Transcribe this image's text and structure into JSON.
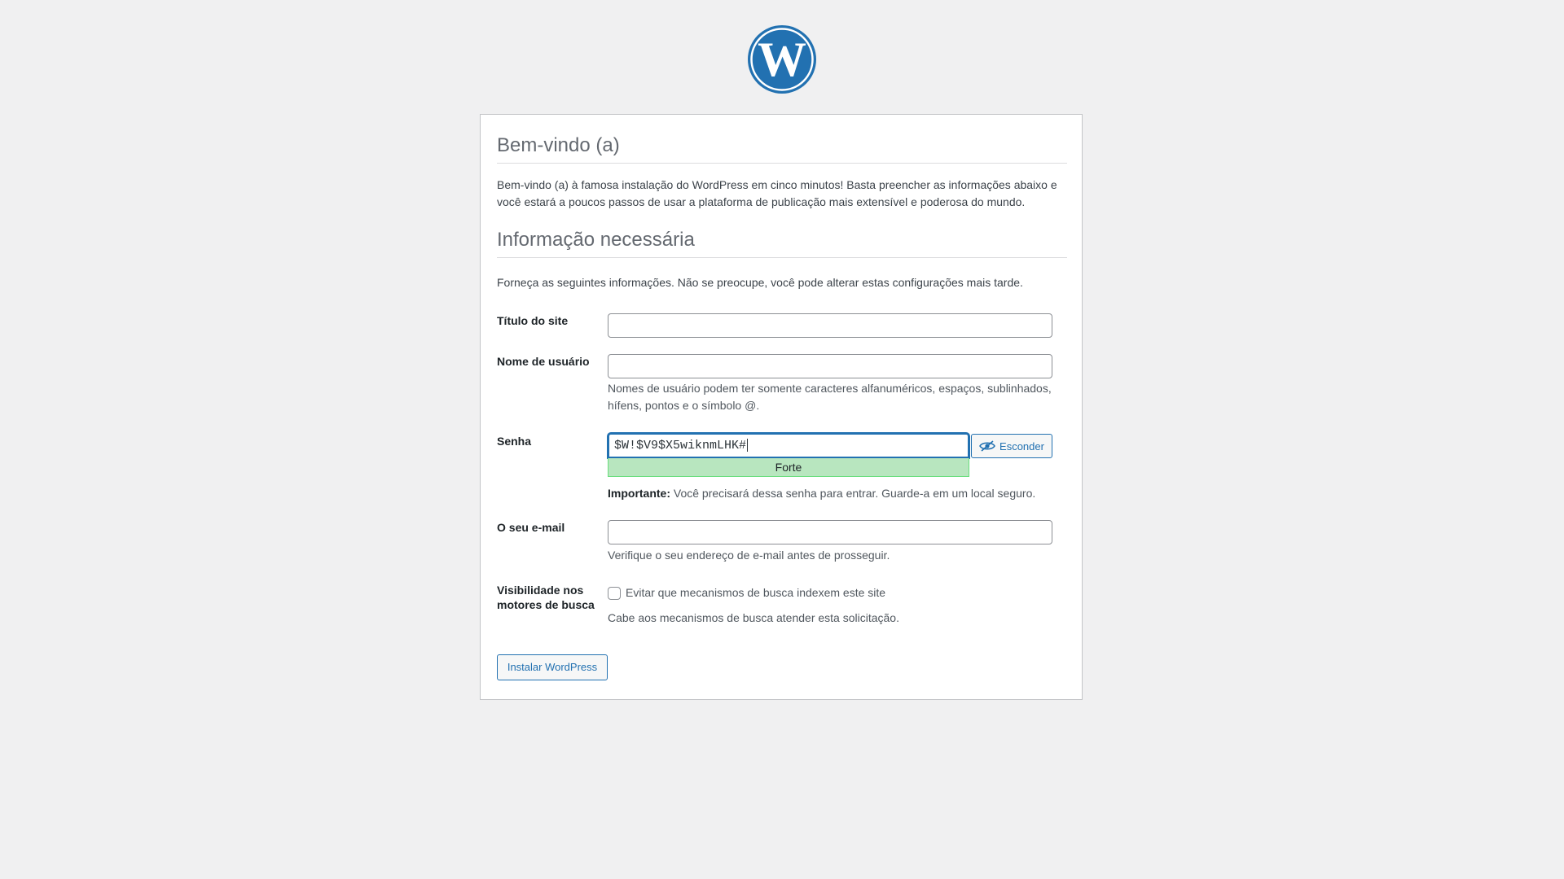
{
  "logo": {
    "icon": "wordpress-logo-icon",
    "color": "#2271b1"
  },
  "welcome": {
    "title": "Bem-vindo (a)",
    "text": "Bem-vindo (a) à famosa instalação do WordPress em cinco minutos! Basta preencher as informações abaixo e você estará a poucos passos de usar a plataforma de publicação mais extensível e poderosa do mundo."
  },
  "info": {
    "title": "Informação necessária",
    "text": "Forneça as seguintes informações. Não se preocupe, você pode alterar estas configurações mais tarde."
  },
  "form": {
    "site_title": {
      "label": "Título do site",
      "value": ""
    },
    "username": {
      "label": "Nome de usuário",
      "value": "",
      "description": "Nomes de usuário podem ter somente caracteres alfanuméricos, espaços, sublinhados, hífens, pontos e o símbolo @."
    },
    "password": {
      "label": "Senha",
      "value": "$W!$V9$X5wiknmLHK#",
      "strength": "Forte",
      "hide_label": "Esconder",
      "hide_icon": "eye-slash-icon",
      "important_label": "Importante:",
      "important_text": " Você precisará dessa senha para entrar. Guarde-a em um local seguro."
    },
    "email": {
      "label": "O seu e-mail",
      "value": "",
      "description": "Verifique o seu endereço de e-mail antes de prosseguir."
    },
    "visibility": {
      "label": "Visibilidade nos motores de busca",
      "checkbox_label": "Evitar que mecanismos de busca indexem este site",
      "checked": false,
      "description": "Cabe aos mecanismos de busca atender esta solicitação."
    },
    "submit_label": "Instalar WordPress"
  },
  "colors": {
    "accent": "#2271b1",
    "strength_strong_bg": "#b8e6bf",
    "background": "#f0f0f1"
  }
}
